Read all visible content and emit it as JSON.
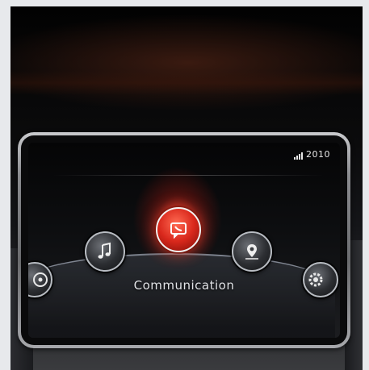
{
  "status_bar": {
    "clock": "2010",
    "signal_icon": "signal-bars-icon"
  },
  "home_menu": {
    "selected_label": "Communication",
    "items": [
      {
        "name": "entertainment",
        "icon": "media-disc-icon"
      },
      {
        "name": "music",
        "icon": "music-note-icon"
      },
      {
        "name": "communication",
        "icon": "phone-message-icon",
        "selected": true
      },
      {
        "name": "navigation",
        "icon": "map-pin-icon"
      },
      {
        "name": "settings",
        "icon": "gear-icon"
      }
    ]
  },
  "colors": {
    "accent": "#e0281c",
    "text": "#e2e4e8"
  }
}
